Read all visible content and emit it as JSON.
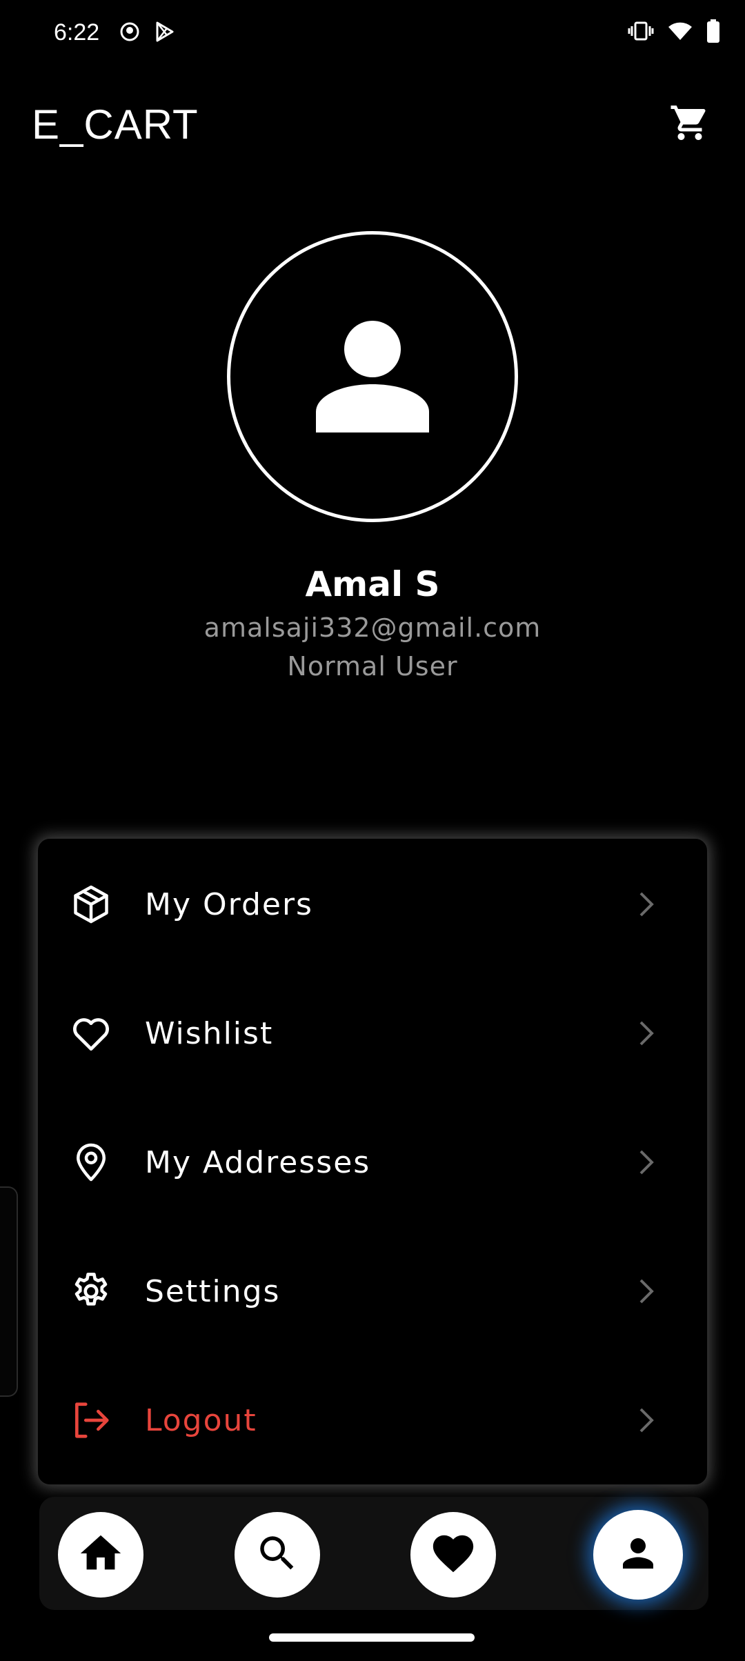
{
  "status_bar": {
    "time": "6:22",
    "left_icons": [
      "notification-app-icon",
      "play-store-icon"
    ],
    "right_icons": [
      "vibrate-icon",
      "wifi-icon",
      "battery-icon"
    ]
  },
  "app_bar": {
    "title": "E_CART",
    "cart_icon": "cart-icon"
  },
  "profile": {
    "avatar_icon": "person-icon",
    "name": "Amal S",
    "email": "amalsaji332@gmail.com",
    "role": "Normal User"
  },
  "menu": {
    "items": [
      {
        "label": "My Orders",
        "icon": "package-icon"
      },
      {
        "label": "Wishlist",
        "icon": "heart-outline-icon"
      },
      {
        "label": "My Addresses",
        "icon": "location-pin-icon"
      },
      {
        "label": "Settings",
        "icon": "gear-icon"
      },
      {
        "label": "Logout",
        "icon": "logout-icon"
      }
    ]
  },
  "bottom_nav": {
    "items": [
      {
        "name": "home",
        "icon": "home-icon"
      },
      {
        "name": "search",
        "icon": "search-icon"
      },
      {
        "name": "wishlist",
        "icon": "heart-icon"
      },
      {
        "name": "profile",
        "icon": "person-icon",
        "active": true
      }
    ]
  },
  "colors": {
    "background": "#000000",
    "accent_glow": "#1e78dc",
    "logout": "#e8453c",
    "muted_text": "#9a9a9a"
  }
}
